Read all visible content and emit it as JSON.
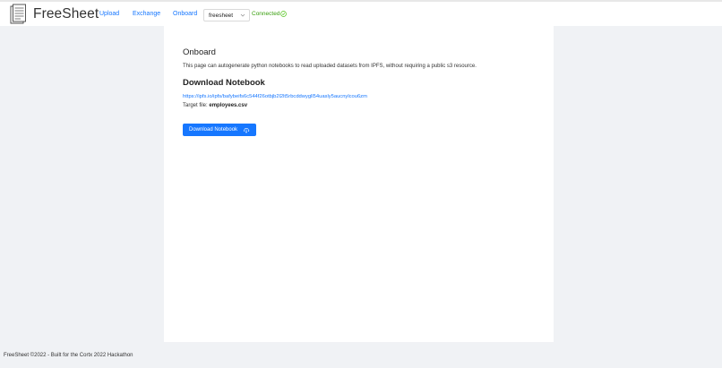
{
  "header": {
    "brand": "FreeSheet",
    "nav": [
      {
        "label": "Upload"
      },
      {
        "label": "Exchange"
      },
      {
        "label": "Onboard"
      }
    ],
    "network_select": {
      "value": "freesheet"
    },
    "status": {
      "label": "Connected",
      "color": "#389e0d",
      "icon": "check-circle-icon"
    }
  },
  "main": {
    "title": "Onboard",
    "description": "This page can autogenerate python notebooks to read uploaded datasets from IPFS, without requiring a public s3 resource.",
    "download": {
      "heading": "Download Notebook",
      "link": "https://ipfs.io/ipfs/bafybeifs6c544f26otbjb2l2lt5rbcddwygll54uasly5aucnylcou6zm",
      "target_label": "Target file: ",
      "target_file": "employees.csv",
      "button_label": "Download Notebook",
      "button_icon": "cloud-download-icon"
    }
  },
  "footer": {
    "text": "FreeSheet ©2022 - Built for the Cortx 2022 Hackathon"
  },
  "colors": {
    "accent": "#1677ff",
    "background": "#f0f2f5",
    "surface": "#ffffff"
  }
}
